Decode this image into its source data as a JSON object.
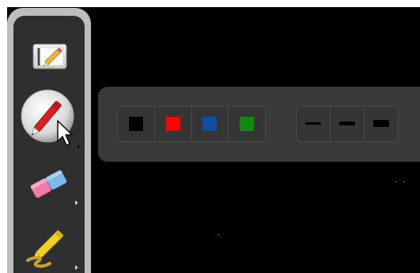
{
  "toolbar": {
    "tools": [
      {
        "name": "select"
      },
      {
        "name": "pen",
        "active": true
      },
      {
        "name": "eraser"
      },
      {
        "name": "highlighter"
      }
    ]
  },
  "options_panel": {
    "colors": [
      "#000000",
      "#ff0000",
      "#0f4ea0",
      "#0f8a0f"
    ],
    "line_widths": [
      "thin",
      "medium",
      "thick"
    ]
  }
}
